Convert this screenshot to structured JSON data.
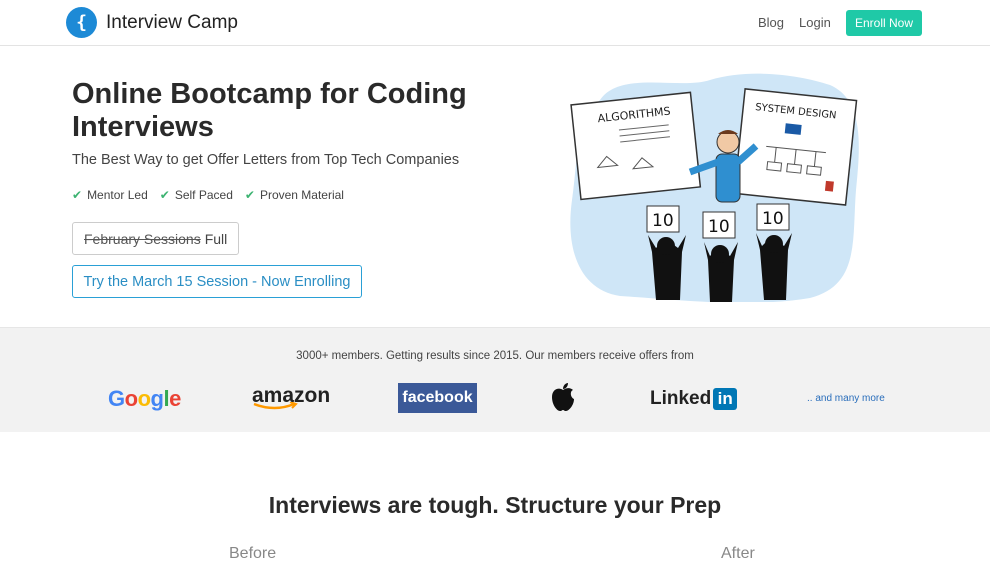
{
  "nav": {
    "brand": "Interview Camp",
    "logo_glyph": "{",
    "links": [
      "Blog",
      "Login"
    ],
    "enroll": "Enroll Now",
    "accent_color": "#1fc9a7"
  },
  "hero": {
    "title": "Online Bootcamp for Coding Interviews",
    "subtitle": "The Best Way to get Offer Letters from Top Tech Companies",
    "features": [
      "Mentor Led",
      "Self Paced",
      "Proven Material"
    ],
    "sessions_struck": "February Sessions",
    "sessions_status": "Full",
    "cta": "Try the March 15 Session - Now Enrolling"
  },
  "illustration": {
    "board_left": "ALGORITHMS",
    "board_right": "SYSTEM DESIGN",
    "scores": [
      "10",
      "10",
      "10"
    ]
  },
  "logos": {
    "caption": "3000+ members. Getting results since 2015. Our members receive offers from",
    "companies": [
      "Google",
      "amazon",
      "facebook",
      "Apple",
      "Linked",
      "in"
    ],
    "more": ".. and many more"
  },
  "section": {
    "title": "Interviews are tough. Structure your Prep",
    "before": "Before",
    "after": "After"
  }
}
